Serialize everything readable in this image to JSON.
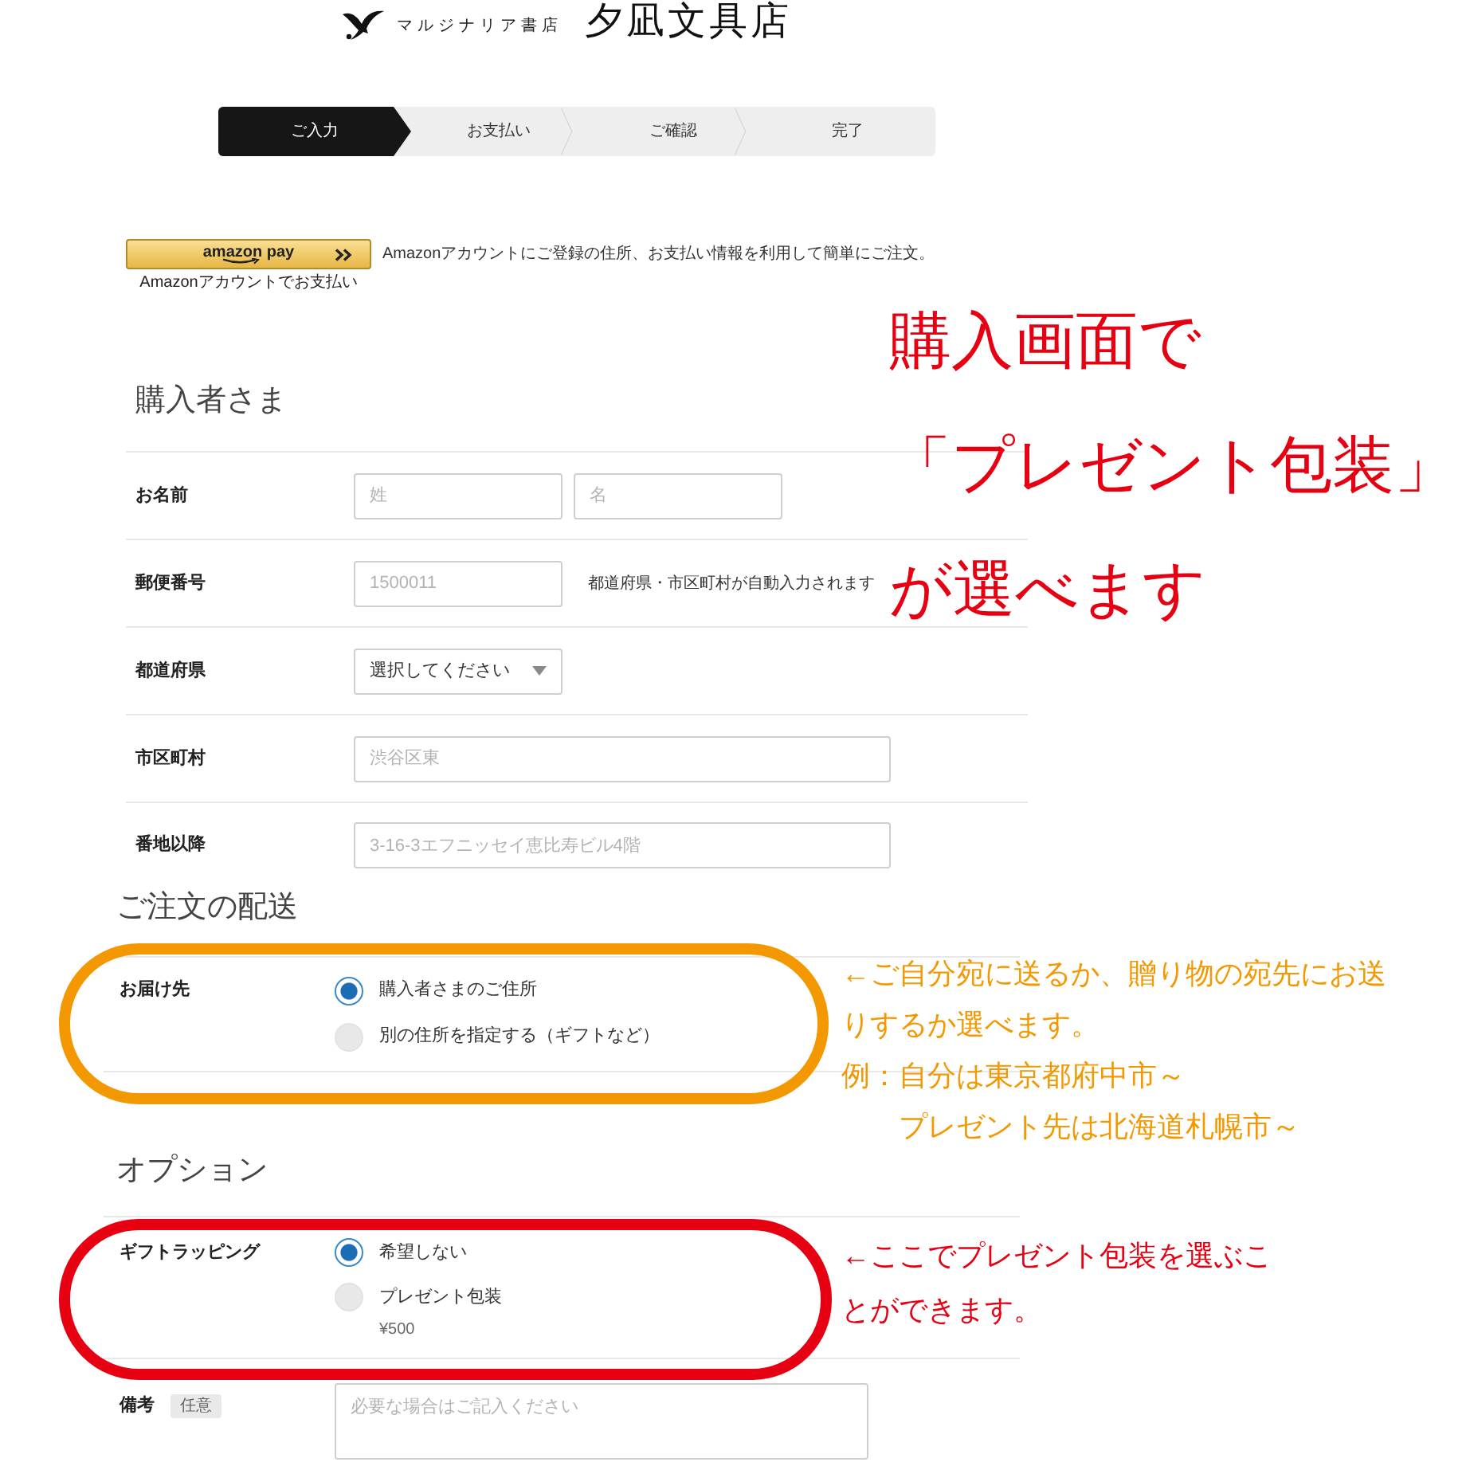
{
  "brand": {
    "subtitle": "マルジナリア書店",
    "title": "夕凪文具店"
  },
  "steps": [
    {
      "label": "ご入力",
      "active": true
    },
    {
      "label": "お支払い",
      "active": false
    },
    {
      "label": "ご確認",
      "active": false
    },
    {
      "label": "完了",
      "active": false
    }
  ],
  "amazon_pay": {
    "button_label": "amazon pay",
    "caption": "Amazonアカウントでお支払い",
    "description": "Amazonアカウントにご登録の住所、お支払い情報を利用して簡単にご注文。"
  },
  "headline": {
    "lines": [
      "購入画面で",
      "「プレゼント包装」",
      "が選べます"
    ]
  },
  "buyer": {
    "title": "購入者さま",
    "rows": [
      {
        "label": "お名前",
        "fields": [
          {
            "kind": "short_input",
            "placeholder": "姓"
          },
          {
            "kind": "short_input",
            "placeholder": "名"
          }
        ]
      },
      {
        "label": "郵便番号",
        "fields": [
          {
            "kind": "short_input",
            "placeholder": "1500011"
          }
        ],
        "note": "都道府県・市区町村が自動入力されます"
      },
      {
        "label": "都道府県",
        "fields": [
          {
            "kind": "select",
            "value": "選択してください"
          }
        ]
      },
      {
        "label": "市区町村",
        "fields": [
          {
            "kind": "long_input",
            "placeholder": "渋谷区東"
          }
        ]
      },
      {
        "label": "番地以降",
        "fields": [
          {
            "kind": "long_input",
            "placeholder": "3-16-3エフニッセイ恵比寿ビル4階"
          }
        ]
      }
    ]
  },
  "delivery": {
    "title": "ご注文の配送",
    "label": "お届け先",
    "choices": [
      {
        "label": "購入者さまのご住所",
        "selected": true
      },
      {
        "label": "別の住所を指定する（ギフトなど）",
        "selected": false
      }
    ],
    "annotation": {
      "color": "#f39800",
      "text": "←ご自分宛に送るか、贈り物の宛先にお送りするか選べます。",
      "example_lines": [
        "例：自分は東京都府中市～",
        "プレゼント先は北海道札幌市～"
      ]
    }
  },
  "gift_options": {
    "title": "オプション",
    "label": "ギフトラッピング",
    "choices": [
      {
        "label": "希望しない",
        "selected": true
      },
      {
        "label": "プレゼント包装",
        "price": "¥500",
        "selected": false
      }
    ],
    "annotation": {
      "color": "#e60012",
      "text": "←ここでプレゼント包装を選ぶことができます。"
    },
    "memo": {
      "label": "備考",
      "tag": "任意",
      "placeholder": "必要な場合はご記入ください"
    }
  }
}
